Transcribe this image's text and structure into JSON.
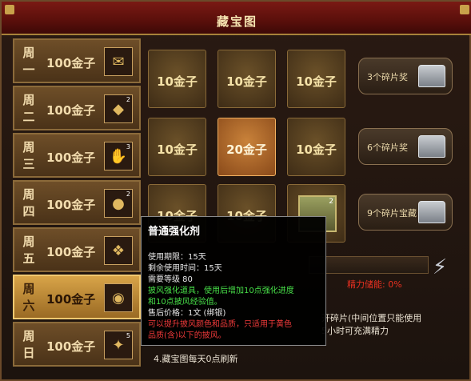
{
  "window": {
    "title": "藏宝图"
  },
  "days": [
    {
      "label": "周一",
      "reward": "100金子",
      "icon": "scroll-icon",
      "badge": ""
    },
    {
      "label": "周二",
      "reward": "100金子",
      "icon": "gem-icon",
      "badge": "2"
    },
    {
      "label": "周三",
      "reward": "100金子",
      "icon": "hand-orb-icon",
      "badge": "3"
    },
    {
      "label": "周四",
      "reward": "100金子",
      "icon": "potion-icon",
      "badge": "2"
    },
    {
      "label": "周五",
      "reward": "100金子",
      "icon": "dragon-icon",
      "badge": ""
    },
    {
      "label": "周六",
      "reward": "100金子",
      "icon": "orb-icon",
      "badge": ""
    },
    {
      "label": "周日",
      "reward": "100金子",
      "icon": "lantern-icon",
      "badge": "5"
    }
  ],
  "grid": {
    "cells": [
      {
        "text": "10金子",
        "highlight": false
      },
      {
        "text": "10金子",
        "highlight": false
      },
      {
        "text": "10金子",
        "highlight": false
      },
      {
        "text": "10金子",
        "highlight": false
      },
      {
        "text": "20金子",
        "highlight": true
      },
      {
        "text": "10金子",
        "highlight": false
      },
      {
        "text": "10金子",
        "highlight": false
      },
      {
        "text": "10金子",
        "highlight": false
      },
      {
        "text": "",
        "item_badge": "2",
        "icon": "reinforce-item-icon"
      }
    ]
  },
  "rewards": [
    {
      "label": "3个碎片奖",
      "icon": "silver-chest-icon"
    },
    {
      "label": "6个碎片奖",
      "icon": "silver-chest-icon"
    },
    {
      "label": "9个碎片宝藏",
      "icon": "silver-chest-icon"
    }
  ],
  "energy": {
    "label": "精力储能: 0%",
    "icon": "lightning-icon"
  },
  "info_lines": [
    "开碎片(中间位置只能使用",
    "5小时可充满精力"
  ],
  "rule4": "4.藏宝图每天0点刷新",
  "tooltip": {
    "name": "普通强化剂",
    "lines": [
      {
        "text": "使用期限：15天",
        "color": "white"
      },
      {
        "text": "剩余使用时间：15天",
        "color": "white"
      },
      {
        "text": "需要等级 80",
        "color": "white"
      },
      {
        "text": "披风强化道具，使用后增加10点强化进度",
        "color": "green"
      },
      {
        "text": "和10点披风经验值。",
        "color": "green"
      },
      {
        "text": "售后价格：1文 (绑银)",
        "color": "white"
      },
      {
        "text": "可以提升披风颜色和品质，只适用于黄色",
        "color": "red"
      },
      {
        "text": "品质(含)以下的披风。",
        "color": "red"
      }
    ]
  },
  "colors": {
    "title_bar": "#5a0f0b",
    "accent_gold": "#d8a448",
    "warning_red": "#e83020",
    "tooltip_green": "#48e048"
  }
}
